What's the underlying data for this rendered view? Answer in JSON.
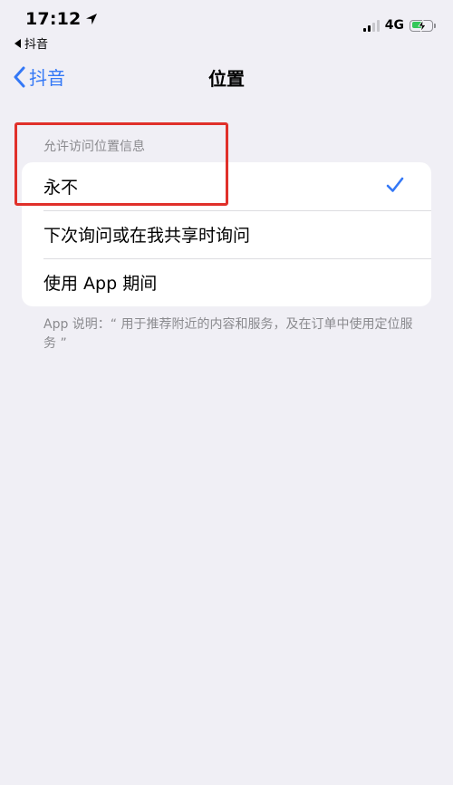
{
  "status_bar": {
    "time": "17:12",
    "back_app": "抖音",
    "network": "4G",
    "battery_level": 0.6,
    "icons": [
      "location-arrow-icon",
      "signal-icon",
      "battery-charging-icon"
    ]
  },
  "nav": {
    "back_label": "抖音",
    "title": "位置"
  },
  "section": {
    "header": "允许访问位置信息",
    "options": [
      {
        "label": "永不",
        "selected": true
      },
      {
        "label": "下次询问或在我共享时询问",
        "selected": false
      },
      {
        "label": "使用 App 期间",
        "selected": false
      }
    ],
    "footer": "App 说明：“ 用于推荐附近的内容和服务，及在订单中使用定位服务 ”"
  },
  "colors": {
    "accent": "#3478f6",
    "background": "#f0eff5",
    "annotation": "#e0302a"
  }
}
